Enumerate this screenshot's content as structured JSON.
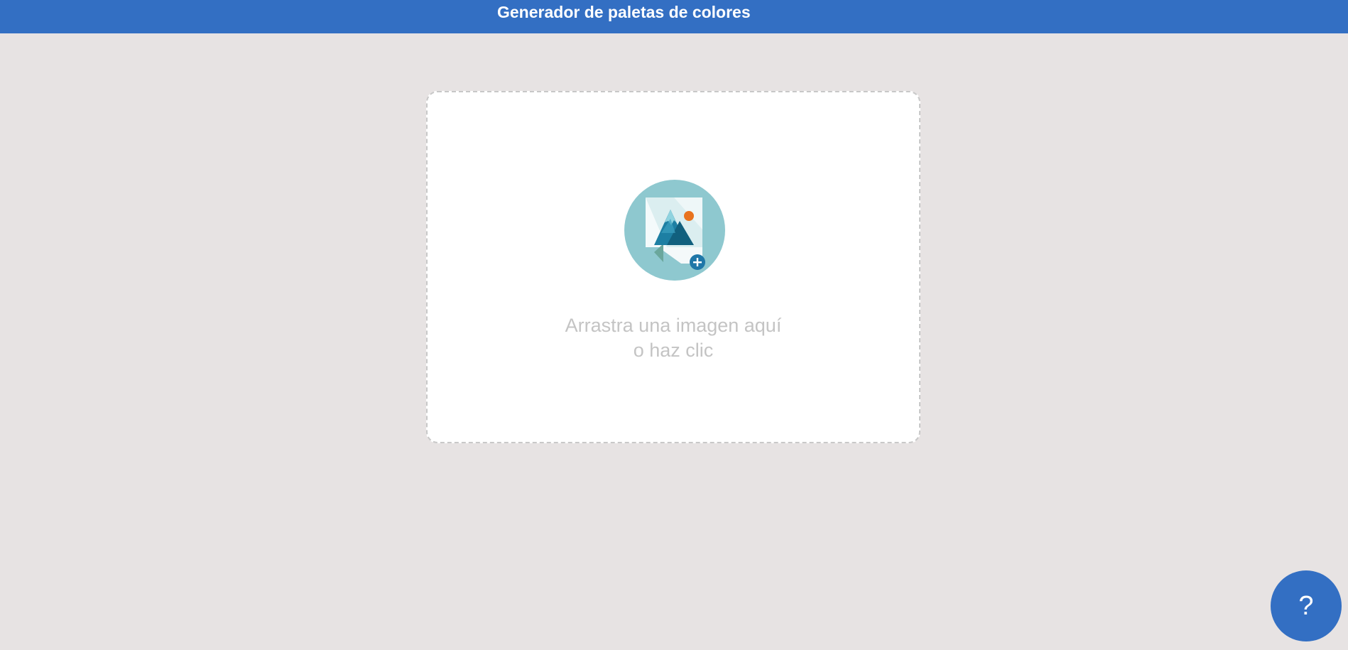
{
  "header": {
    "title": "Generador de paletas de colores"
  },
  "dropzone": {
    "line1": "Arrastra una imagen aquí",
    "line2": "o haz clic",
    "icon": "image-upload-icon"
  },
  "help": {
    "label": "?"
  },
  "colors": {
    "header_bg": "#336fc3",
    "page_bg": "#e7e3e3",
    "icon_circle": "#8ec8cf",
    "icon_plus": "#1f77a8",
    "icon_sun": "#e8731f"
  }
}
